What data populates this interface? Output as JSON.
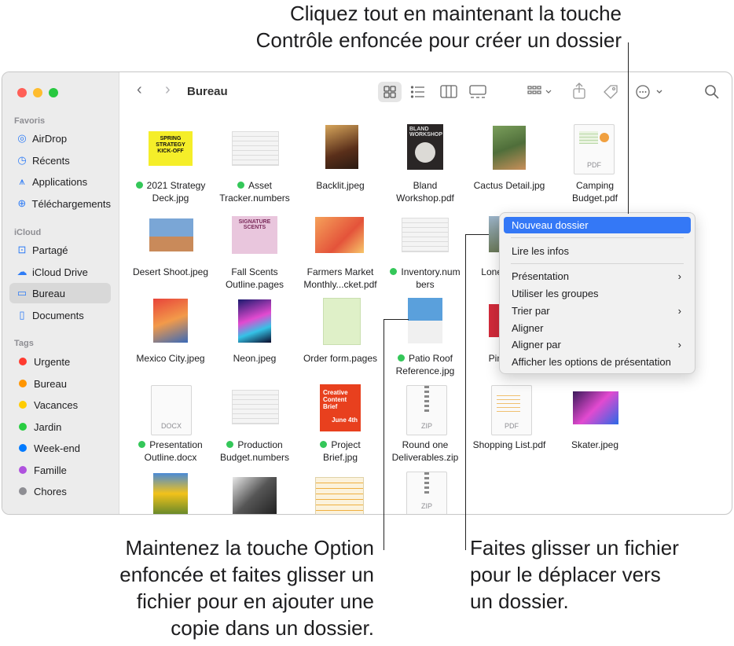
{
  "callouts": {
    "top_line1": "Cliquez tout en maintenant la touche",
    "top_line2": "Contrôle enfoncée pour créer un dossier",
    "left_line1": "Maintenez la touche Option",
    "left_line2": "enfoncée et faites glisser un",
    "left_line3": "fichier pour en ajouter une",
    "left_line4": "copie dans un dossier.",
    "right_line1": "Faites glisser un fichier",
    "right_line2": "pour le déplacer vers",
    "right_line3": "un dossier."
  },
  "sidebar": {
    "favorites_header": "Favoris",
    "favorites": [
      {
        "label": "AirDrop",
        "icon": "airdrop-icon"
      },
      {
        "label": "Récents",
        "icon": "clock-icon"
      },
      {
        "label": "Applications",
        "icon": "applications-icon"
      },
      {
        "label": "Téléchargements",
        "icon": "download-icon"
      }
    ],
    "icloud_header": "iCloud",
    "icloud": [
      {
        "label": "Partagé",
        "icon": "shared-folder-icon"
      },
      {
        "label": "iCloud Drive",
        "icon": "cloud-icon"
      },
      {
        "label": "Bureau",
        "icon": "desktop-icon",
        "selected": true
      },
      {
        "label": "Documents",
        "icon": "document-icon"
      }
    ],
    "tags_header": "Tags",
    "tags": [
      {
        "label": "Urgente",
        "color": "#ff3b30"
      },
      {
        "label": "Bureau",
        "color": "#ff9500"
      },
      {
        "label": "Vacances",
        "color": "#ffcc00"
      },
      {
        "label": "Jardin",
        "color": "#28cd41"
      },
      {
        "label": "Week-end",
        "color": "#007aff"
      },
      {
        "label": "Famille",
        "color": "#af52de"
      },
      {
        "label": "Chores",
        "color": "#8e8e93"
      }
    ]
  },
  "toolbar": {
    "title": "Bureau"
  },
  "files": [
    {
      "l1": "2021 Strategy",
      "l2": "Deck.jpg",
      "tag": true
    },
    {
      "l1": "Asset",
      "l2": "Tracker.numbers",
      "tag": true
    },
    {
      "l1": "Backlit.jpeg",
      "l2": ""
    },
    {
      "l1": "Bland",
      "l2": "Workshop.pdf"
    },
    {
      "l1": "Cactus Detail.jpg",
      "l2": ""
    },
    {
      "l1": "Camping",
      "l2": "Budget.pdf"
    },
    {
      "l1": "Desert Shoot.jpeg",
      "l2": ""
    },
    {
      "l1": "Fall Scents",
      "l2": "Outline.pages"
    },
    {
      "l1": "Farmers Market",
      "l2": "Monthly...cket.pdf"
    },
    {
      "l1": "Inventory.num",
      "l2": "bers",
      "tag": true
    },
    {
      "l1": "Lone",
      "l2": ""
    },
    {
      "l1": "Mexico City.jpeg",
      "l2": ""
    },
    {
      "l1": "Neon.jpeg",
      "l2": ""
    },
    {
      "l1": "Order form.pages",
      "l2": ""
    },
    {
      "l1": "Patio Roof",
      "l2": "Reference.jpg",
      "tag": true
    },
    {
      "l1": "Pin",
      "l2": ""
    },
    {
      "l1": "Presentation",
      "l2": "Outline.docx",
      "tag": true
    },
    {
      "l1": "Production",
      "l2": "Budget.numbers",
      "tag": true
    },
    {
      "l1": "Project",
      "l2": "Brief.jpg",
      "tag": true
    },
    {
      "l1": "Round one",
      "l2": "Deliverables.zip"
    },
    {
      "l1": "Shopping List.pdf",
      "l2": ""
    },
    {
      "l1": "Skater.jpeg",
      "l2": ""
    }
  ],
  "thumb_text": {
    "strategy": "SPRING STRATEGY KICK-OFF",
    "bland": "BLAND WORKSHOP",
    "pdf": "PDF",
    "signature": "SIGNATURE SCENTS",
    "docx": "DOCX",
    "zip": "ZIP",
    "creative": "Creative Content Brief",
    "june": "June 4th",
    "pdf_badge": "PDF"
  },
  "context_menu": {
    "new_folder": "Nouveau dossier",
    "get_info": "Lire les infos",
    "presentation": "Présentation",
    "use_groups": "Utiliser les groupes",
    "sort_by": "Trier par",
    "align": "Aligner",
    "align_by": "Aligner par",
    "view_options": "Afficher les options de présentation",
    "chevron": "›"
  },
  "colors": {
    "accent": "#3478f6",
    "tag_green": "#34c759"
  }
}
